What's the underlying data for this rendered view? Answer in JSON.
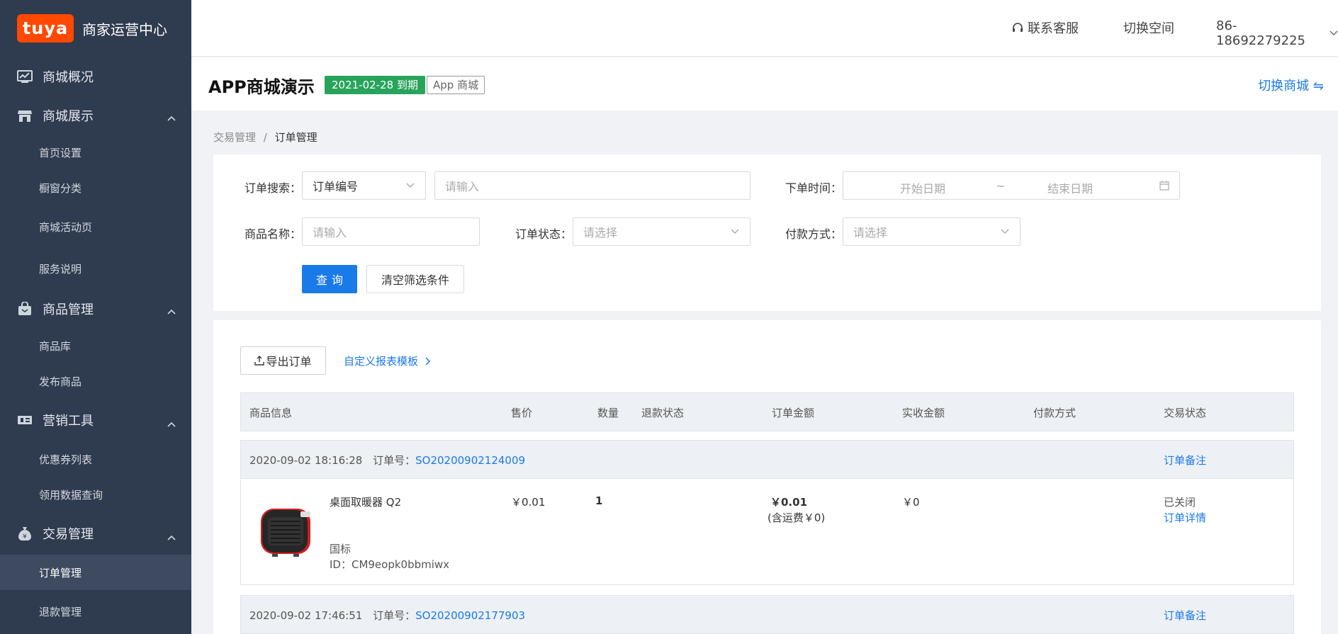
{
  "brand": {
    "logo_text": "tuya",
    "title": "商家运营中心"
  },
  "sidebar": {
    "groups": [
      {
        "label": "商城概况",
        "icon": "chart-icon",
        "items": []
      },
      {
        "label": "商城展示",
        "icon": "store-icon",
        "items": [
          "首页设置",
          "橱窗分类",
          "商城活动页",
          "服务说明"
        ]
      },
      {
        "label": "商品管理",
        "icon": "bag-icon",
        "items": [
          "商品库",
          "发布商品"
        ]
      },
      {
        "label": "营销工具",
        "icon": "ticket-icon",
        "items": [
          "优惠券列表",
          "领用数据查询"
        ]
      },
      {
        "label": "交易管理",
        "icon": "money-bag-icon",
        "items": [
          "订单管理",
          "退款管理"
        ]
      }
    ],
    "active_item": "订单管理"
  },
  "topbar": {
    "support": "联系客服",
    "switch_space": "切换空间",
    "account": "86-18692279225"
  },
  "store": {
    "name": "APP商城演示",
    "expiry_badge": "2021-02-28 到期",
    "type_badge": "App 商城",
    "switch_label": "切换商城 ⇋"
  },
  "breadcrumb": {
    "parent": "交易管理",
    "sep": "/",
    "current": "订单管理"
  },
  "filters": {
    "order_search_label": "订单搜索：",
    "order_search_type": "订单编号",
    "order_search_placeholder": "请输入",
    "order_time_label": "下单时间：",
    "start_date_placeholder": "开始日期",
    "date_sep": "~",
    "end_date_placeholder": "结束日期",
    "product_name_label": "商品名称：",
    "product_name_placeholder": "请输入",
    "order_status_label": "订单状态：",
    "order_status_placeholder": "请选择",
    "payment_label": "付款方式：",
    "payment_placeholder": "请选择",
    "query_button": "查询",
    "clear_button": "清空筛选条件"
  },
  "orders": {
    "export_button": "导出订单",
    "custom_template_link": "自定义报表模板",
    "columns": [
      "商品信息",
      "售价",
      "数量",
      "退款状态",
      "订单金额",
      "实收金额",
      "付款方式",
      "交易状态"
    ],
    "order_no_label": "订单号：",
    "remark_label": "订单备注",
    "list": [
      {
        "time": "2020-09-02 18:16:28",
        "order_no": "SO20200902124009",
        "product_name": "桌面取暖器 Q2",
        "spec": "国标",
        "product_id": "ID：CM9eopk0bbmiwx",
        "price": "￥0.01",
        "qty": "1",
        "order_amount": "￥0.01",
        "shipping": "(含运费￥0)",
        "received": "￥0",
        "status": "已关闭",
        "detail_link": "订单详情"
      },
      {
        "time": "2020-09-02 17:46:51",
        "order_no": "SO20200902177903"
      }
    ]
  },
  "colors": {
    "accent": "#1a7ae8",
    "sidebar_bg": "#2f3b4f",
    "logo": "#ff4800",
    "badge_green": "#28a35c"
  }
}
